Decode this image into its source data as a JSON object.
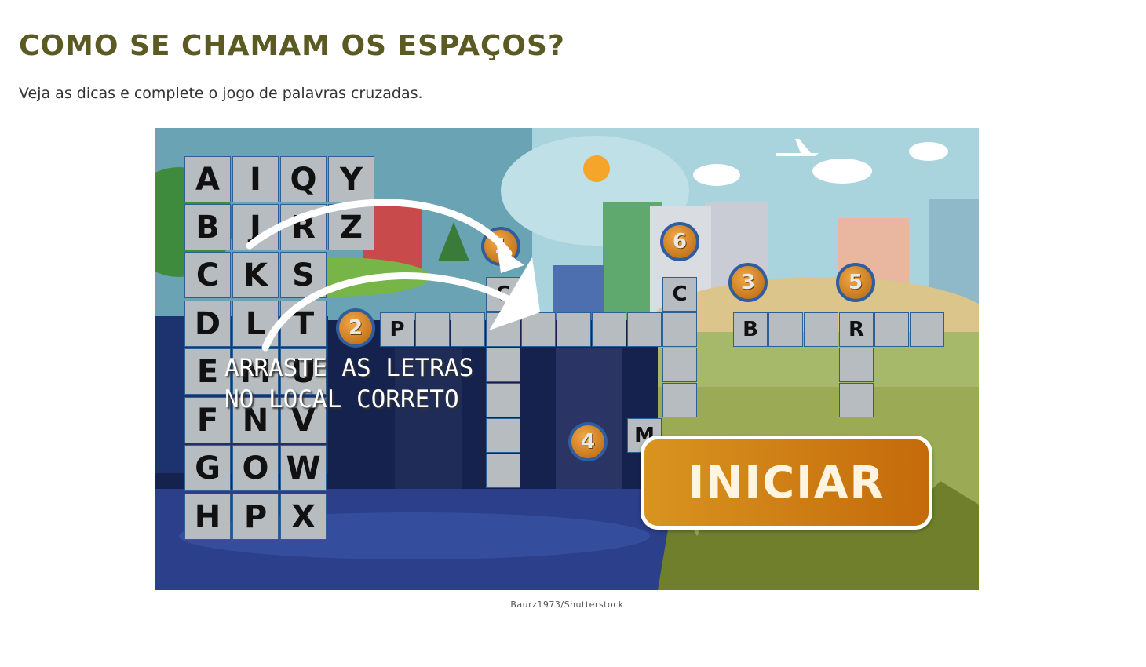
{
  "header": {
    "title": "COMO SE CHAMAM OS ESPAÇOS?",
    "subtitle": "Veja as dicas e complete o jogo de palavras cruzadas."
  },
  "game": {
    "hint": "ARRASTE AS LETRAS\nNO LOCAL CORRETO",
    "start_label": "INICIAR",
    "letters": [
      "A",
      "B",
      "C",
      "D",
      "E",
      "F",
      "G",
      "H",
      "I",
      "J",
      "K",
      "L",
      "M",
      "N",
      "O",
      "P",
      "Q",
      "R",
      "S",
      "T",
      "U",
      "V",
      "W",
      "X",
      "Y",
      "Z"
    ],
    "badges": [
      "1",
      "2",
      "3",
      "4",
      "5",
      "6"
    ],
    "prefilled": [
      "C",
      "P",
      "C",
      "B",
      "R",
      "M"
    ]
  },
  "credit": "Baurz1973/Shutterstock",
  "colors": {
    "title": "#5b5a22",
    "tile": "#b7bcc1",
    "grid_border": "#2c5f95",
    "badge": "#d98a2a",
    "button": "#c9791a"
  }
}
